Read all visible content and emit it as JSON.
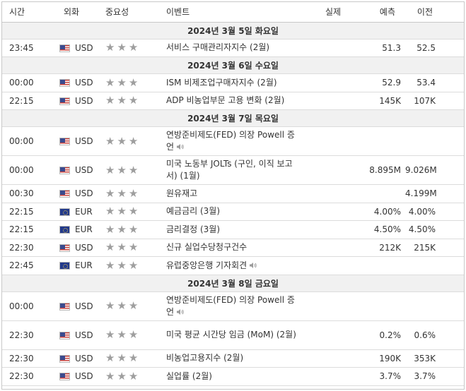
{
  "header": {
    "time": "시간",
    "currency": "외화",
    "importance": "중요성",
    "event": "이벤트",
    "actual": "실제",
    "forecast": "예측",
    "previous": "이전"
  },
  "icons": {
    "star": "star-icon",
    "speaker": "speaker-icon",
    "us_flag": "us-flag-icon",
    "eu_flag": "eu-flag-icon"
  },
  "colors": {
    "star": "#9e9e9e",
    "date_row_bg": "#f1f1f1",
    "border": "#c8c8c8"
  },
  "star_glyph": "★",
  "sections": [
    {
      "date": "2024년 3월 5일 화요일",
      "events": [
        {
          "time": "23:45",
          "currency": "USD",
          "flag": "us",
          "stars": 3,
          "event": "서비스 구매관리자지수 (2월)",
          "speaker": false,
          "actual": "",
          "forecast": "51.3",
          "previous": "52.5"
        }
      ]
    },
    {
      "date": "2024년 3월 6일 수요일",
      "events": [
        {
          "time": "00:00",
          "currency": "USD",
          "flag": "us",
          "stars": 3,
          "event": "ISM 비제조업구매자지수 (2월)",
          "speaker": false,
          "actual": "",
          "forecast": "52.9",
          "previous": "53.4"
        },
        {
          "time": "22:15",
          "currency": "USD",
          "flag": "us",
          "stars": 3,
          "event": "ADP 비농업부문 고용 변화 (2월)",
          "speaker": false,
          "actual": "",
          "forecast": "145K",
          "previous": "107K"
        }
      ]
    },
    {
      "date": "2024년 3월 7일 목요일",
      "events": [
        {
          "time": "00:00",
          "currency": "USD",
          "flag": "us",
          "stars": 3,
          "event": "연방준비제도(FED) 의장 Powell 증언",
          "speaker": true,
          "tall": true,
          "actual": "",
          "forecast": "",
          "previous": ""
        },
        {
          "time": "00:00",
          "currency": "USD",
          "flag": "us",
          "stars": 3,
          "event": "미국 노동부 JOLTs (구인, 이직 보고서) (1월)",
          "speaker": false,
          "tall": true,
          "actual": "",
          "forecast": "8.895M",
          "previous": "9.026M"
        },
        {
          "time": "00:30",
          "currency": "USD",
          "flag": "us",
          "stars": 3,
          "event": "원유재고",
          "speaker": false,
          "actual": "",
          "forecast": "",
          "previous": "4.199M"
        },
        {
          "time": "22:15",
          "currency": "EUR",
          "flag": "eu",
          "stars": 3,
          "event": "예금금리 (3월)",
          "speaker": false,
          "actual": "",
          "forecast": "4.00%",
          "previous": "4.00%"
        },
        {
          "time": "22:15",
          "currency": "EUR",
          "flag": "eu",
          "stars": 3,
          "event": "금리결정 (3월)",
          "speaker": false,
          "actual": "",
          "forecast": "4.50%",
          "previous": "4.50%"
        },
        {
          "time": "22:30",
          "currency": "USD",
          "flag": "us",
          "stars": 3,
          "event": "신규 실업수당청구건수",
          "speaker": false,
          "actual": "",
          "forecast": "212K",
          "previous": "215K"
        },
        {
          "time": "22:45",
          "currency": "EUR",
          "flag": "eu",
          "stars": 3,
          "event": "유럽중앙은행 기자회견",
          "speaker": true,
          "actual": "",
          "forecast": "",
          "previous": ""
        }
      ]
    },
    {
      "date": "2024년 3월 8일 금요일",
      "events": [
        {
          "time": "00:00",
          "currency": "USD",
          "flag": "us",
          "stars": 3,
          "event": "연방준비제도(FED) 의장 Powell 증언",
          "speaker": true,
          "tall": true,
          "actual": "",
          "forecast": "",
          "previous": ""
        },
        {
          "time": "22:30",
          "currency": "USD",
          "flag": "us",
          "stars": 3,
          "event": "미국 평균 시간당 임금 (MoM) (2월)",
          "speaker": false,
          "tall": true,
          "actual": "",
          "forecast": "0.2%",
          "previous": "0.6%"
        },
        {
          "time": "22:30",
          "currency": "USD",
          "flag": "us",
          "stars": 3,
          "event": "비농업고용지수 (2월)",
          "speaker": false,
          "actual": "",
          "forecast": "190K",
          "previous": "353K"
        },
        {
          "time": "22:30",
          "currency": "USD",
          "flag": "us",
          "stars": 3,
          "event": "실업률 (2월)",
          "speaker": false,
          "actual": "",
          "forecast": "3.7%",
          "previous": "3.7%"
        }
      ]
    }
  ]
}
